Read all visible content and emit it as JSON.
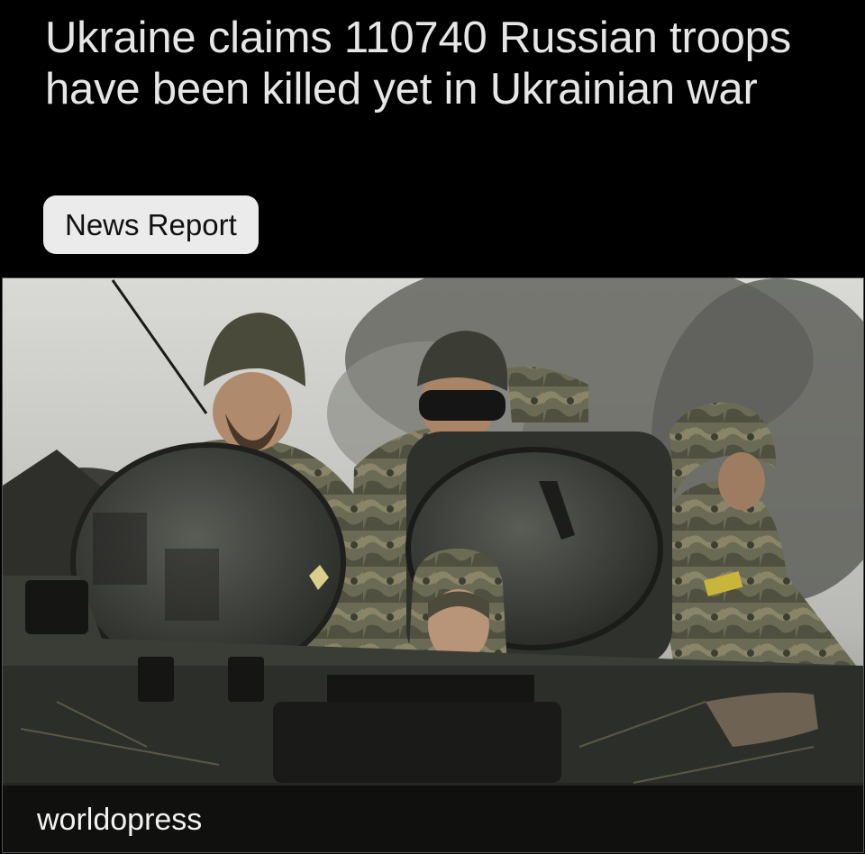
{
  "post": {
    "headline": "Ukraine claims 110740 Russian troops have been killed yet in Ukrainian war",
    "tag_label": "News Report",
    "source": "worldopress"
  },
  "colors": {
    "background": "#000000",
    "headline_text": "#e6e6e6",
    "tag_background": "#ebebeb",
    "tag_text": "#111111"
  },
  "image": {
    "subject": "soldiers riding on an armored vehicle",
    "style": "photograph, desaturated, overcast trees background"
  }
}
